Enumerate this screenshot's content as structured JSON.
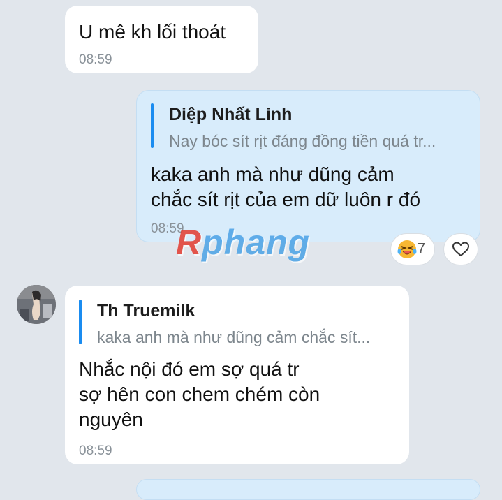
{
  "messages": [
    {
      "text": "U mê kh lối thoát",
      "time": "08:59"
    },
    {
      "quote_name": "Diệp Nhất Linh",
      "quote_text": "Nay bóc sít rịt đáng đồng tiền quá tr...",
      "text": "kaka anh mà như dũng cảm\nchắc sít rịt của em dữ luôn r đó",
      "time": "08:59",
      "reaction_count": "7"
    },
    {
      "quote_name": "Th Truemilk",
      "quote_text": "kaka anh mà như dũng cảm chắc sít...",
      "text": "Nhắc nội đó em sợ quá tr\nsợ hên con chem chém còn\nnguyên",
      "time": "08:59"
    }
  ],
  "watermark": {
    "first": "R",
    "rest": "phang"
  },
  "icons": {
    "reaction": "laughing-face-icon",
    "like": "heart-outline-icon"
  },
  "colors": {
    "background": "#e1e6ec",
    "outgoing": "#d8ecfb",
    "quote_bar": "#1a8cf0"
  }
}
